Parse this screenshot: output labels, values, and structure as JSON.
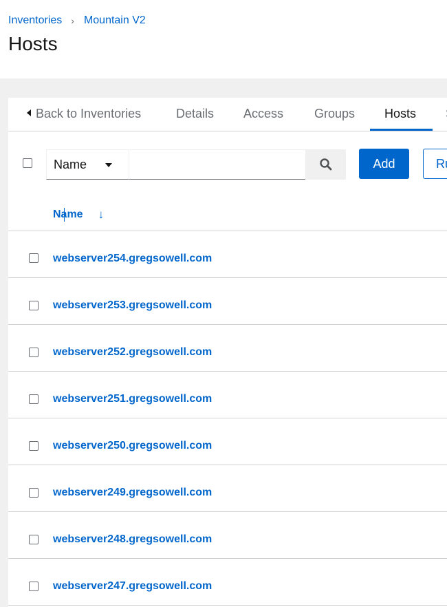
{
  "breadcrumb": {
    "items": [
      "Inventories",
      "Mountain V2"
    ],
    "separator": "›"
  },
  "page": {
    "title": "Hosts"
  },
  "tabs": [
    {
      "label": "Back to Inventories",
      "active": false
    },
    {
      "label": "Details",
      "active": false
    },
    {
      "label": "Access",
      "active": false
    },
    {
      "label": "Groups",
      "active": false
    },
    {
      "label": "Hosts",
      "active": true
    },
    {
      "label": "S",
      "active": false
    }
  ],
  "toolbar": {
    "filter_label": "Name",
    "search_value": "",
    "search_icon": "search-icon",
    "add_label": "Add",
    "run_label": "Ru"
  },
  "table": {
    "column_header": "Name",
    "sort_icon": "↓",
    "rows": [
      "webserver254.gregsowell.com",
      "webserver253.gregsowell.com",
      "webserver252.gregsowell.com",
      "webserver251.gregsowell.com",
      "webserver250.gregsowell.com",
      "webserver249.gregsowell.com",
      "webserver248.gregsowell.com",
      "webserver247.gregsowell.com"
    ]
  },
  "colors": {
    "accent": "#0066cc",
    "text": "#151515",
    "muted": "#6a6e73",
    "background": "#f0f0f0"
  }
}
